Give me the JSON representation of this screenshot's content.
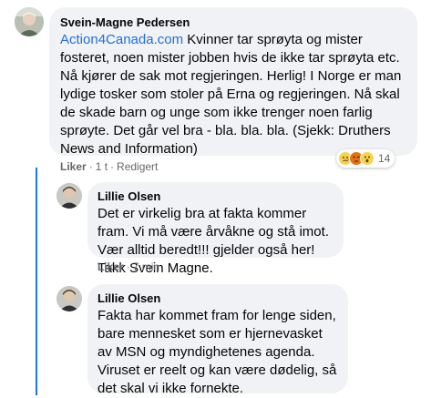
{
  "comments": [
    {
      "author": "Svein-Magne Pedersen",
      "link_text": "Action4Canada.com",
      "text": " Kvinner tar sprøyta og mister fosteret, noen mister jobben hvis de ikke tar sprøyta etc. Nå kjører de sak mot regjeringen. Herlig! I Norge er man lydige tosker som stoler på Erna og regjeringen. Nå skal de skade barn og unge som ikke trenger noen farlig sprøyte. Det går vel bra - bla. bla. bla. (Sjekk: Druthers News and Information)",
      "like_label": "Liker",
      "time": "1 t",
      "edited_label": "Redigert",
      "reaction_count": "14",
      "reaction_icons": [
        "sad-face-icon",
        "angry-face-icon",
        "wow-face-icon"
      ]
    },
    {
      "author": "Lillie Olsen",
      "text": "Det er virkelig bra at fakta kommer fram. Vi må være årvåkne og stå imot. Vær alltid beredt!!! gjelder også her! Takk Svein Magne.",
      "like_label": "Liker",
      "time": "7 min"
    },
    {
      "author": "Lillie Olsen",
      "text": "Fakta har kommet fram for lenge siden, bare mennesket som er hjernevasket av MSN og myndighetenes agenda.\nViruset er reelt og kan være dødelig, så det skal vi ikke fornekte."
    }
  ],
  "colors": {
    "bubble": "#f0f2f5",
    "link": "#216fdb",
    "thread_line": "#1877f2",
    "meta": "#65676b"
  }
}
